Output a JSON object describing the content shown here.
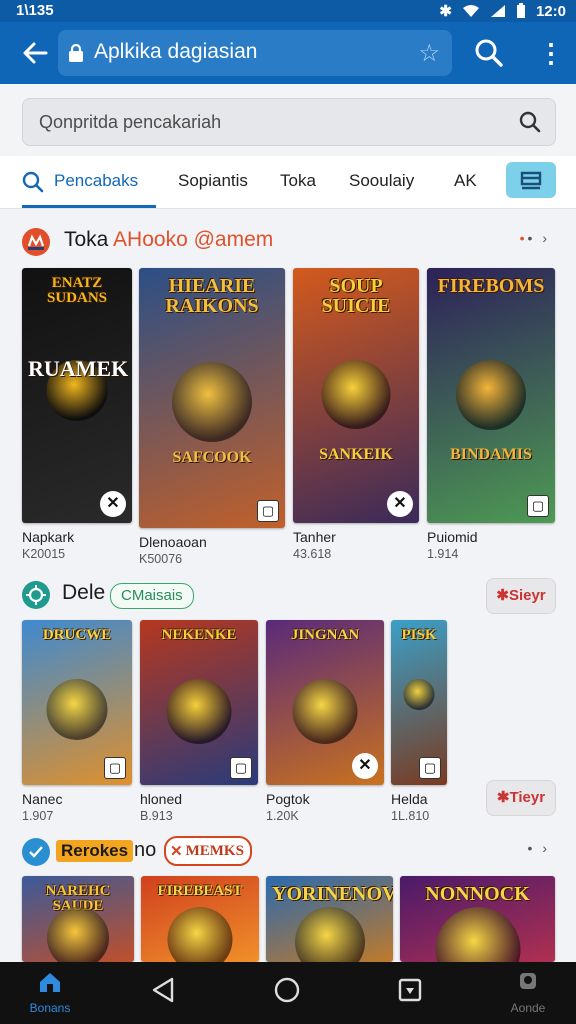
{
  "status": {
    "time_left": "1\\135",
    "time_right": "12:0"
  },
  "appbar": {
    "title": "Aplkika dagiasian"
  },
  "search": {
    "placeholder": "Qonpritda pencakariah"
  },
  "tabs": [
    {
      "label": "Pencabaks",
      "active": true
    },
    {
      "label": "Sopiantis"
    },
    {
      "label": "Toka"
    },
    {
      "label": "Sooulaiy"
    },
    {
      "label": "AK"
    }
  ],
  "section1": {
    "title": "Toka",
    "title_accent": "AHooko @amem",
    "cards": [
      {
        "title": "ENATZ SUDANS",
        "title2": "RUAMEK",
        "name": "Napkark",
        "sub": "K20015",
        "colors": [
          "#111111",
          "#2a2a2a"
        ],
        "accent": "#f2b61f"
      },
      {
        "title": "HIEARIE RAIKONS",
        "title2": "SAFCOOK",
        "name": "Dlenoaoan",
        "sub": "K50076",
        "colors": [
          "#2b4f86",
          "#c2602a"
        ],
        "accent": "#f0c040"
      },
      {
        "title": "SOUP SUICIE",
        "title2": "SANKEIK",
        "name": "Tanher",
        "sub": "43.618",
        "colors": [
          "#d35a1d",
          "#3a2a5a"
        ],
        "accent": "#f7d13a"
      },
      {
        "title": "FIREBOMS",
        "title2": "BINDAMIS",
        "name": "Puiomid",
        "sub": "1.914",
        "colors": [
          "#2d2159",
          "#4e9a54"
        ],
        "accent": "#f4b53a"
      }
    ]
  },
  "section2": {
    "title": "Dele",
    "chip": "CMaisais",
    "button1": "Sieyr",
    "button2": "Tieyr",
    "cards": [
      {
        "title": "DRUCWE",
        "name": "Nanec",
        "sub": "1.907",
        "colors": [
          "#3e8ad0",
          "#e0902c"
        ],
        "accent": "#f6d645"
      },
      {
        "title": "NEKENKE",
        "name": "hloned",
        "sub": "B.913",
        "colors": [
          "#b5381f",
          "#2a3b7a"
        ],
        "accent": "#f4cf3a"
      },
      {
        "title": "JINGNAN",
        "name": "Pogtok",
        "sub": "1.20K",
        "colors": [
          "#5a2a7a",
          "#c9721f"
        ],
        "accent": "#f6d645"
      },
      {
        "title": "PISK",
        "name": "Helda",
        "sub": "1L.810",
        "colors": [
          "#3aa0c8",
          "#7a3a20"
        ],
        "accent": "#f0d040"
      }
    ]
  },
  "section3": {
    "title_a": "Rerokes",
    "title_b": "no",
    "title_c": "MEMKS",
    "cards": [
      {
        "title": "NAREHC SAUDE",
        "colors": [
          "#3a5a9a",
          "#c0502a"
        ],
        "accent": "#f6c63a"
      },
      {
        "title": "FIREBEAST",
        "colors": [
          "#d0401f",
          "#f0902a"
        ],
        "accent": "#f6d645"
      },
      {
        "title": "YORINENOVE",
        "colors": [
          "#2a6ab0",
          "#c07a2a"
        ],
        "accent": "#f6d645"
      },
      {
        "title": "NONNOCK",
        "colors": [
          "#4a1a6a",
          "#b03050"
        ],
        "accent": "#f6d645"
      }
    ]
  },
  "nav": {
    "home": "Bonans",
    "right": "Aonde"
  },
  "colors": {
    "primary": "#0f65b6",
    "accent": "#e0522c"
  }
}
